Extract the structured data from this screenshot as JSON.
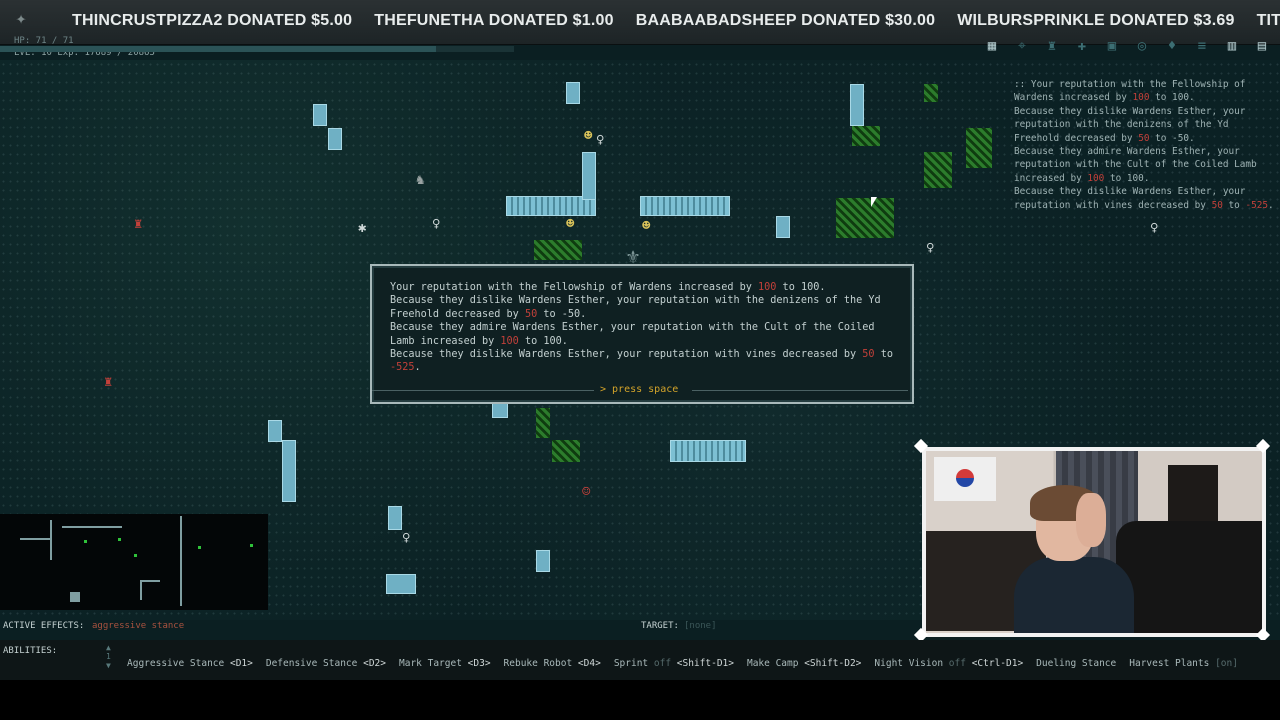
{
  "ticker": {
    "donations": [
      "THINCRUSTPIZZA2 DONATED $5.00",
      "THEFUNETHA DONATED $1.00",
      "BAABAABADSHEEP DONATED $30.00",
      "WILBURSPRINKLE DONATED $3.69",
      "TITANIUMSKYWALKER DON"
    ]
  },
  "stats": {
    "hp": "HP: 71 / 71",
    "level_exp": "LVL: 10 Exp: 17689 / 20865",
    "xp_fraction": 0.848
  },
  "top_icons": [
    "character-icon",
    "inventory-icon",
    "equipment-icon",
    "skills-icon",
    "journal-icon",
    "quests-icon",
    "reputation-icon",
    "message-log-icon",
    "map-icon",
    "menu-icon"
  ],
  "message_log": {
    "lines": [
      ":: Your reputation with the Fellowship of Wardens increased by ",
      "100",
      " to 100.",
      "Because they dislike Wardens Esther, your reputation with the denizens of the Yd Freehold decreased by ",
      "50",
      " to -50.",
      "Because they admire Wardens Esther, your reputation with the Cult of the Coiled Lamb increased by ",
      "100",
      " to 100.",
      "Because they dislike Wardens Esther, your reputation with vines decreased by ",
      "50",
      " to ",
      "-525",
      "."
    ]
  },
  "popup": {
    "line1_a": "Your reputation with the Fellowship of Wardens increased by ",
    "line1_num": "100",
    "line1_b": " to 100.",
    "line2_a": "Because they dislike Wardens Esther, your reputation with the denizens of the Yd Freehold decreased by ",
    "line2_num": "50",
    "line2_b": " to -50.",
    "line3_a": "Because they admire Wardens Esther, your reputation with the Cult of the Coiled Lamb increased by ",
    "line3_num": "100",
    "line3_b": " to 100.",
    "line4_a": "Because they dislike Wardens Esther, your reputation with vines decreased by ",
    "line4_num": "50",
    "line4_b": " to ",
    "line4_val": "-525",
    "line4_c": ".",
    "press": "> press space"
  },
  "effects": {
    "label": "ACTIVE EFFECTS:",
    "value": "aggressive stance",
    "target_label": "TARGET:",
    "target_value": "[none]"
  },
  "abilities": {
    "label": "ABILITIES:",
    "page": "1",
    "items": [
      {
        "name": "Aggressive Stance",
        "key": "<D1>"
      },
      {
        "name": "Defensive Stance",
        "key": "<D2>"
      },
      {
        "name": "Mark Target",
        "key": "<D3>"
      },
      {
        "name": "Rebuke Robot",
        "key": "<D4>"
      },
      {
        "name": "Sprint",
        "state": "off",
        "key": "<Shift-D1>"
      },
      {
        "name": "Make Camp",
        "key": "<Shift-D2>"
      },
      {
        "name": "Night Vision",
        "state": "off",
        "key": "<Ctrl-D1>"
      },
      {
        "name": "Dueling Stance",
        "key": ""
      },
      {
        "name": "Harvest Plants",
        "key": "[on]"
      }
    ]
  },
  "colors": {
    "accent_red": "#c2403a",
    "prompt_yellow": "#d4a42a",
    "wall_blue": "#6fb0c4",
    "plant_green": "#2c7c2c"
  }
}
